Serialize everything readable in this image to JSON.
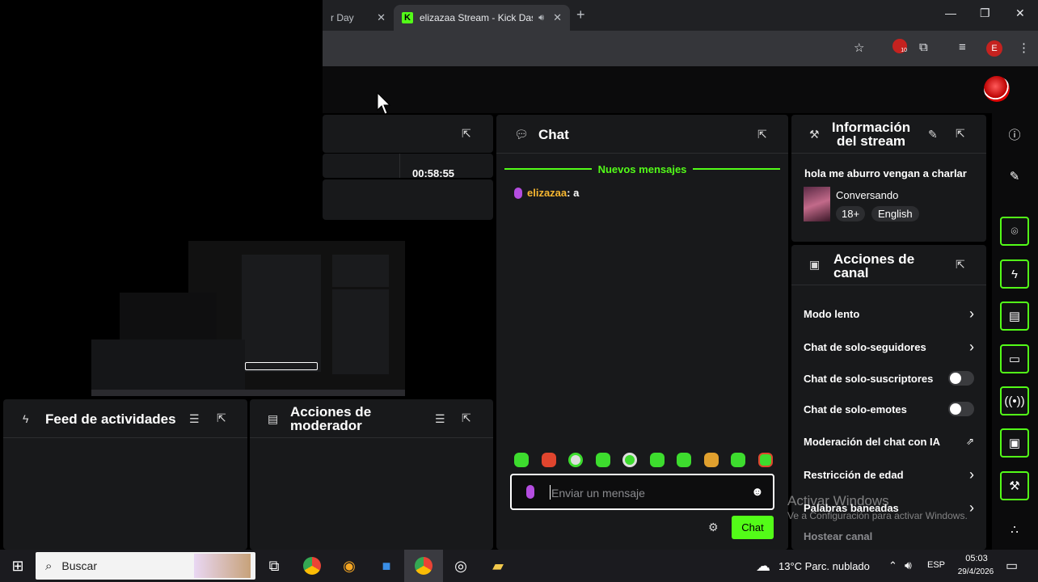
{
  "browser": {
    "tabs": [
      {
        "title": "r Day"
      },
      {
        "title": "elizazaa Stream - Kick Dash"
      }
    ],
    "profile_letter": "E",
    "extension_badge": "10"
  },
  "stream_panel": {
    "timer": "00:58:55"
  },
  "chat": {
    "title": "Chat",
    "divider_label": "Nuevos mensajes",
    "messages": [
      {
        "user": "elizazaa",
        "text": "a"
      }
    ],
    "input_placeholder": "Enviar un mensaje",
    "send_label": "Chat"
  },
  "stream_info": {
    "title": "Información del stream",
    "stream_title": "hola me aburro vengan a charlar",
    "category": "Conversando",
    "tags": [
      "18+",
      "English"
    ]
  },
  "channel_actions": {
    "title": "Acciones de canal",
    "items": [
      {
        "label": "Modo lento",
        "control": "chevron"
      },
      {
        "label": "Chat de solo-seguidores",
        "control": "chevron"
      },
      {
        "label": "Chat de solo-suscriptores",
        "control": "toggle"
      },
      {
        "label": "Chat de solo-emotes",
        "control": "toggle"
      },
      {
        "label": "Moderación del chat con IA",
        "control": "external"
      },
      {
        "label": "Restricción de edad",
        "control": "chevron"
      },
      {
        "label": "Palabras baneadas",
        "control": "chevron"
      },
      {
        "label": "Hostear canal",
        "control": "none"
      }
    ]
  },
  "activity_feed": {
    "title": "Feed de actividades"
  },
  "mod_actions": {
    "title": "Acciones de moderador"
  },
  "watermark": {
    "line1": "Activar Windows",
    "line2": "Ve a Configuración para activar Windows."
  },
  "taskbar": {
    "search_placeholder": "Buscar",
    "weather": "13°C  Parc. nublado",
    "language": "ESP",
    "time": "05:03",
    "date": "29/4/2026"
  },
  "colors": {
    "accent": "#53fc18",
    "panel": "#18191b",
    "background": "#000000"
  }
}
